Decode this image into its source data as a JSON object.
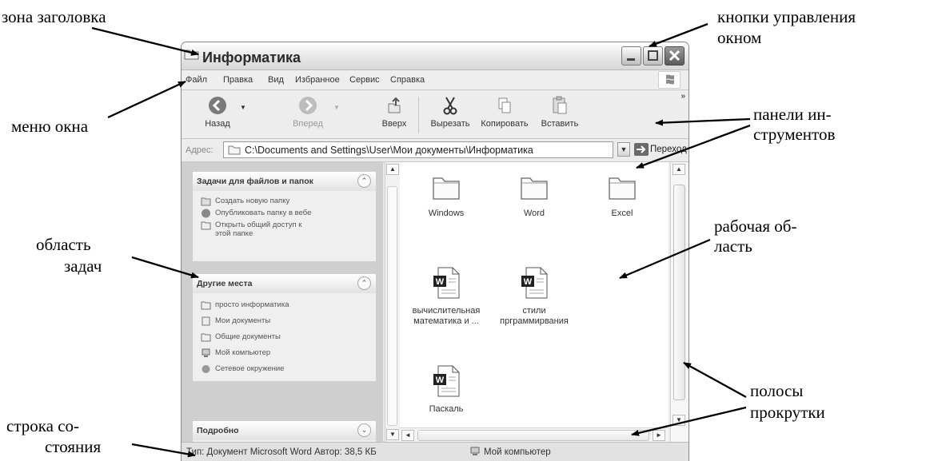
{
  "annotations": {
    "title_zone": "зона заголовка",
    "window_controls_line1": "кнопки управления",
    "window_controls_line2": "окном",
    "window_menu": "меню окна",
    "toolbars_line1": "панели ин-",
    "toolbars_line2": "струментов",
    "task_area_line1": "область",
    "task_area_line2": "задач",
    "work_area_line1": "рабочая об-",
    "work_area_line2": "ласть",
    "scrollbars_line1": "полосы",
    "scrollbars_line2": "прокрутки",
    "status_line1": "строка со-",
    "status_line2": "стояния"
  },
  "window": {
    "title": "Информатика",
    "menu": [
      "Файл",
      "Правка",
      "Вид",
      "Избранное",
      "Сервис",
      "Справка"
    ],
    "toolbar": {
      "back": "Назад",
      "forward": "Вперед",
      "up": "Вверх",
      "cut": "Вырезать",
      "copy": "Копировать",
      "paste": "Вставить"
    },
    "address": {
      "label": "Адрес:",
      "value": "C:\\Documents and Settings\\User\\Мои документы\\Информатика",
      "go": "Переход"
    },
    "tasks_panel": {
      "title": "Задачи для файлов и папок",
      "items": [
        "Создать новую папку",
        "Опубликовать папку в вебе",
        "Открыть общий доступ к",
        "этой папке"
      ]
    },
    "places_panel": {
      "title": "Другие места",
      "items": [
        "просто информатика",
        "Мои документы",
        "Общие документы",
        "Мой компьютер",
        "Сетевое окружение"
      ]
    },
    "details_panel": {
      "title": "Подробно"
    },
    "files": {
      "windows": "Windows",
      "word": "Word",
      "excel": "Excel",
      "doc1_line1": "вычислительная",
      "doc1_line2": "математика и ...",
      "doc2_line1": "стили",
      "doc2_line2": "прграммирвания",
      "doc3": "Паскаль"
    },
    "status": {
      "text": "Тип: Документ Microsoft Word Автор: 38,5 КБ",
      "zone": "Мой компьютер"
    }
  }
}
